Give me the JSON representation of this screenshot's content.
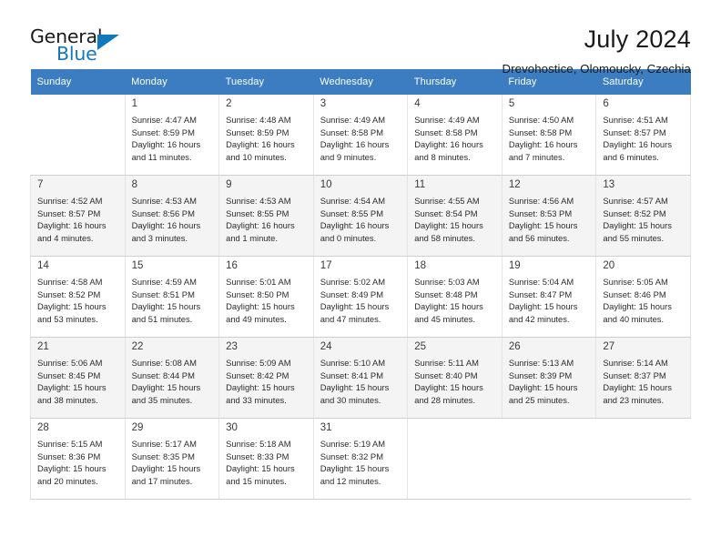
{
  "brand": {
    "word_general": "General",
    "word_blue": "Blue",
    "accent_color": "#1278be",
    "header_color": "#3b7dc0"
  },
  "header": {
    "title": "July 2024",
    "subtitle": "Drevohostice, Olomoucky, Czechia"
  },
  "calendar": {
    "weekday_headers": [
      "Sunday",
      "Monday",
      "Tuesday",
      "Wednesday",
      "Thursday",
      "Friday",
      "Saturday"
    ],
    "weeks": [
      {
        "shaded": false,
        "days": [
          null,
          {
            "day": "1",
            "sunrise": "Sunrise: 4:47 AM",
            "sunset": "Sunset: 8:59 PM",
            "daylight_line1": "Daylight: 16 hours",
            "daylight_line2": "and 11 minutes."
          },
          {
            "day": "2",
            "sunrise": "Sunrise: 4:48 AM",
            "sunset": "Sunset: 8:59 PM",
            "daylight_line1": "Daylight: 16 hours",
            "daylight_line2": "and 10 minutes."
          },
          {
            "day": "3",
            "sunrise": "Sunrise: 4:49 AM",
            "sunset": "Sunset: 8:58 PM",
            "daylight_line1": "Daylight: 16 hours",
            "daylight_line2": "and 9 minutes."
          },
          {
            "day": "4",
            "sunrise": "Sunrise: 4:49 AM",
            "sunset": "Sunset: 8:58 PM",
            "daylight_line1": "Daylight: 16 hours",
            "daylight_line2": "and 8 minutes."
          },
          {
            "day": "5",
            "sunrise": "Sunrise: 4:50 AM",
            "sunset": "Sunset: 8:58 PM",
            "daylight_line1": "Daylight: 16 hours",
            "daylight_line2": "and 7 minutes."
          },
          {
            "day": "6",
            "sunrise": "Sunrise: 4:51 AM",
            "sunset": "Sunset: 8:57 PM",
            "daylight_line1": "Daylight: 16 hours",
            "daylight_line2": "and 6 minutes."
          }
        ]
      },
      {
        "shaded": true,
        "days": [
          {
            "day": "7",
            "sunrise": "Sunrise: 4:52 AM",
            "sunset": "Sunset: 8:57 PM",
            "daylight_line1": "Daylight: 16 hours",
            "daylight_line2": "and 4 minutes."
          },
          {
            "day": "8",
            "sunrise": "Sunrise: 4:53 AM",
            "sunset": "Sunset: 8:56 PM",
            "daylight_line1": "Daylight: 16 hours",
            "daylight_line2": "and 3 minutes."
          },
          {
            "day": "9",
            "sunrise": "Sunrise: 4:53 AM",
            "sunset": "Sunset: 8:55 PM",
            "daylight_line1": "Daylight: 16 hours",
            "daylight_line2": "and 1 minute."
          },
          {
            "day": "10",
            "sunrise": "Sunrise: 4:54 AM",
            "sunset": "Sunset: 8:55 PM",
            "daylight_line1": "Daylight: 16 hours",
            "daylight_line2": "and 0 minutes."
          },
          {
            "day": "11",
            "sunrise": "Sunrise: 4:55 AM",
            "sunset": "Sunset: 8:54 PM",
            "daylight_line1": "Daylight: 15 hours",
            "daylight_line2": "and 58 minutes."
          },
          {
            "day": "12",
            "sunrise": "Sunrise: 4:56 AM",
            "sunset": "Sunset: 8:53 PM",
            "daylight_line1": "Daylight: 15 hours",
            "daylight_line2": "and 56 minutes."
          },
          {
            "day": "13",
            "sunrise": "Sunrise: 4:57 AM",
            "sunset": "Sunset: 8:52 PM",
            "daylight_line1": "Daylight: 15 hours",
            "daylight_line2": "and 55 minutes."
          }
        ]
      },
      {
        "shaded": false,
        "days": [
          {
            "day": "14",
            "sunrise": "Sunrise: 4:58 AM",
            "sunset": "Sunset: 8:52 PM",
            "daylight_line1": "Daylight: 15 hours",
            "daylight_line2": "and 53 minutes."
          },
          {
            "day": "15",
            "sunrise": "Sunrise: 4:59 AM",
            "sunset": "Sunset: 8:51 PM",
            "daylight_line1": "Daylight: 15 hours",
            "daylight_line2": "and 51 minutes."
          },
          {
            "day": "16",
            "sunrise": "Sunrise: 5:01 AM",
            "sunset": "Sunset: 8:50 PM",
            "daylight_line1": "Daylight: 15 hours",
            "daylight_line2": "and 49 minutes."
          },
          {
            "day": "17",
            "sunrise": "Sunrise: 5:02 AM",
            "sunset": "Sunset: 8:49 PM",
            "daylight_line1": "Daylight: 15 hours",
            "daylight_line2": "and 47 minutes."
          },
          {
            "day": "18",
            "sunrise": "Sunrise: 5:03 AM",
            "sunset": "Sunset: 8:48 PM",
            "daylight_line1": "Daylight: 15 hours",
            "daylight_line2": "and 45 minutes."
          },
          {
            "day": "19",
            "sunrise": "Sunrise: 5:04 AM",
            "sunset": "Sunset: 8:47 PM",
            "daylight_line1": "Daylight: 15 hours",
            "daylight_line2": "and 42 minutes."
          },
          {
            "day": "20",
            "sunrise": "Sunrise: 5:05 AM",
            "sunset": "Sunset: 8:46 PM",
            "daylight_line1": "Daylight: 15 hours",
            "daylight_line2": "and 40 minutes."
          }
        ]
      },
      {
        "shaded": true,
        "days": [
          {
            "day": "21",
            "sunrise": "Sunrise: 5:06 AM",
            "sunset": "Sunset: 8:45 PM",
            "daylight_line1": "Daylight: 15 hours",
            "daylight_line2": "and 38 minutes."
          },
          {
            "day": "22",
            "sunrise": "Sunrise: 5:08 AM",
            "sunset": "Sunset: 8:44 PM",
            "daylight_line1": "Daylight: 15 hours",
            "daylight_line2": "and 35 minutes."
          },
          {
            "day": "23",
            "sunrise": "Sunrise: 5:09 AM",
            "sunset": "Sunset: 8:42 PM",
            "daylight_line1": "Daylight: 15 hours",
            "daylight_line2": "and 33 minutes."
          },
          {
            "day": "24",
            "sunrise": "Sunrise: 5:10 AM",
            "sunset": "Sunset: 8:41 PM",
            "daylight_line1": "Daylight: 15 hours",
            "daylight_line2": "and 30 minutes."
          },
          {
            "day": "25",
            "sunrise": "Sunrise: 5:11 AM",
            "sunset": "Sunset: 8:40 PM",
            "daylight_line1": "Daylight: 15 hours",
            "daylight_line2": "and 28 minutes."
          },
          {
            "day": "26",
            "sunrise": "Sunrise: 5:13 AM",
            "sunset": "Sunset: 8:39 PM",
            "daylight_line1": "Daylight: 15 hours",
            "daylight_line2": "and 25 minutes."
          },
          {
            "day": "27",
            "sunrise": "Sunrise: 5:14 AM",
            "sunset": "Sunset: 8:37 PM",
            "daylight_line1": "Daylight: 15 hours",
            "daylight_line2": "and 23 minutes."
          }
        ]
      },
      {
        "shaded": false,
        "days": [
          {
            "day": "28",
            "sunrise": "Sunrise: 5:15 AM",
            "sunset": "Sunset: 8:36 PM",
            "daylight_line1": "Daylight: 15 hours",
            "daylight_line2": "and 20 minutes."
          },
          {
            "day": "29",
            "sunrise": "Sunrise: 5:17 AM",
            "sunset": "Sunset: 8:35 PM",
            "daylight_line1": "Daylight: 15 hours",
            "daylight_line2": "and 17 minutes."
          },
          {
            "day": "30",
            "sunrise": "Sunrise: 5:18 AM",
            "sunset": "Sunset: 8:33 PM",
            "daylight_line1": "Daylight: 15 hours",
            "daylight_line2": "and 15 minutes."
          },
          {
            "day": "31",
            "sunrise": "Sunrise: 5:19 AM",
            "sunset": "Sunset: 8:32 PM",
            "daylight_line1": "Daylight: 15 hours",
            "daylight_line2": "and 12 minutes."
          },
          null,
          null,
          null
        ]
      }
    ]
  }
}
